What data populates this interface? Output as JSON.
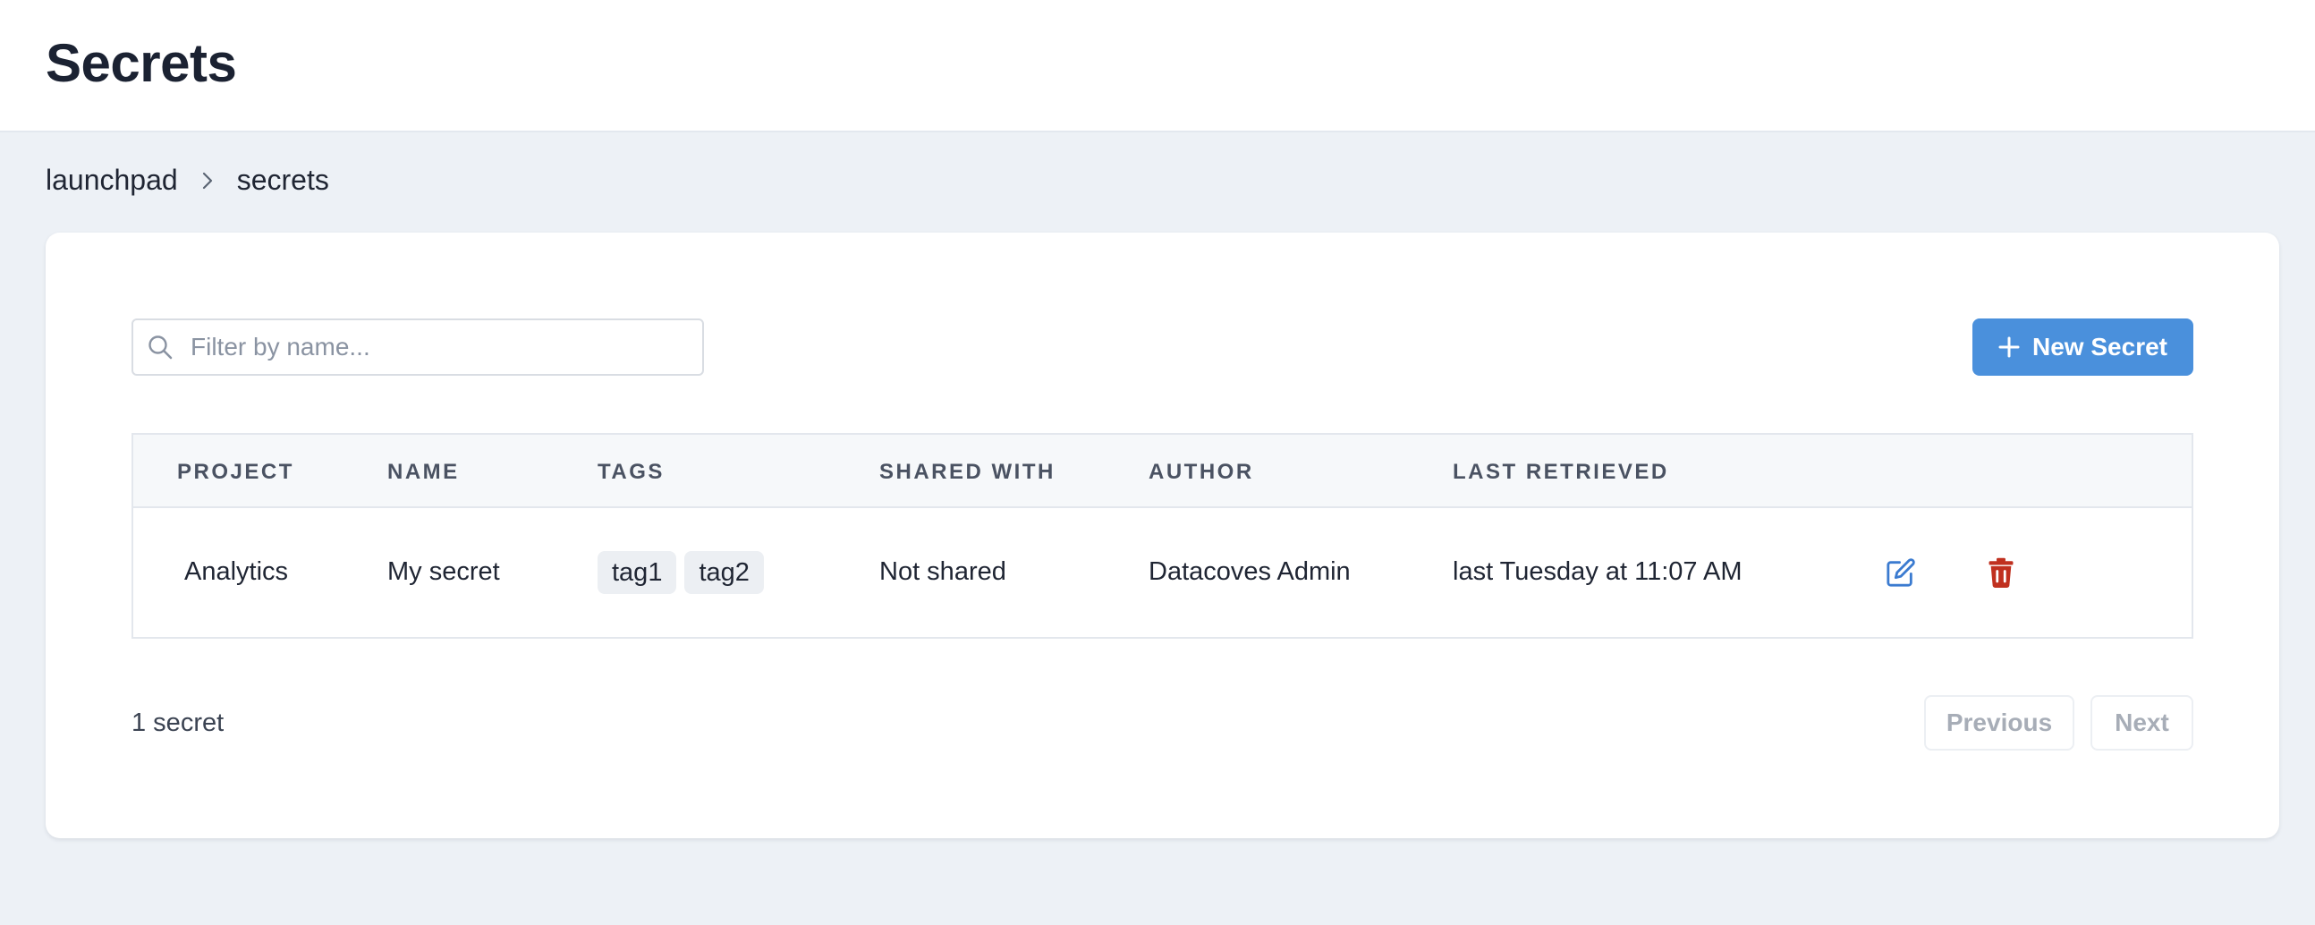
{
  "header": {
    "title": "Secrets"
  },
  "breadcrumb": {
    "items": [
      "launchpad",
      "secrets"
    ]
  },
  "search": {
    "placeholder": "Filter by name...",
    "value": ""
  },
  "toolbar": {
    "new_secret_label": "New Secret"
  },
  "table": {
    "columns": [
      "PROJECT",
      "NAME",
      "TAGS",
      "SHARED WITH",
      "AUTHOR",
      "LAST RETRIEVED"
    ],
    "rows": [
      {
        "project": "Analytics",
        "name": "My secret",
        "tags": [
          "tag1",
          "tag2"
        ],
        "shared_with": "Not shared",
        "author": "Datacoves Admin",
        "last_retrieved": "last Tuesday at 11:07 AM"
      }
    ]
  },
  "footer": {
    "count_label": "1 secret",
    "previous_label": "Previous",
    "next_label": "Next"
  },
  "colors": {
    "accent": "#4a90dc",
    "edit_icon": "#3b7bd0",
    "delete_icon": "#c0301f",
    "page_bg": "#edf1f6"
  },
  "icons": {
    "search": "search-icon",
    "plus": "plus-icon",
    "edit": "edit-icon",
    "delete": "trash-icon",
    "breadcrumb_sep": "chevron-right-icon"
  }
}
